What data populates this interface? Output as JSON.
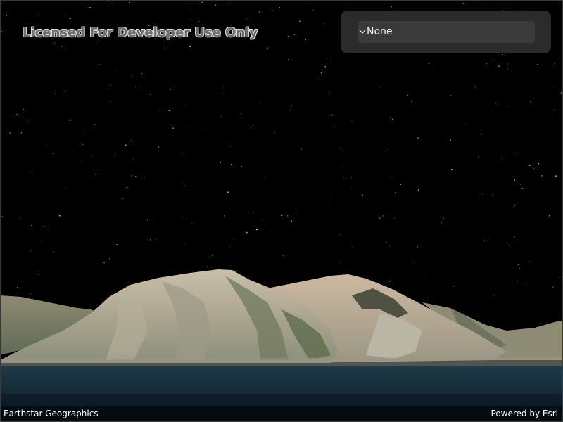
{
  "watermark": {
    "text": "Licensed For Developer Use Only"
  },
  "selector": {
    "value": "None",
    "icon": "chevron-down-icon"
  },
  "attribution": {
    "source": "Earthstar Geographics",
    "powered_by": "Powered by Esri"
  },
  "colors": {
    "sky": "#000000",
    "panel": "#2b2b2b",
    "dropdown": "#3a3a3a",
    "water": "#132531"
  }
}
